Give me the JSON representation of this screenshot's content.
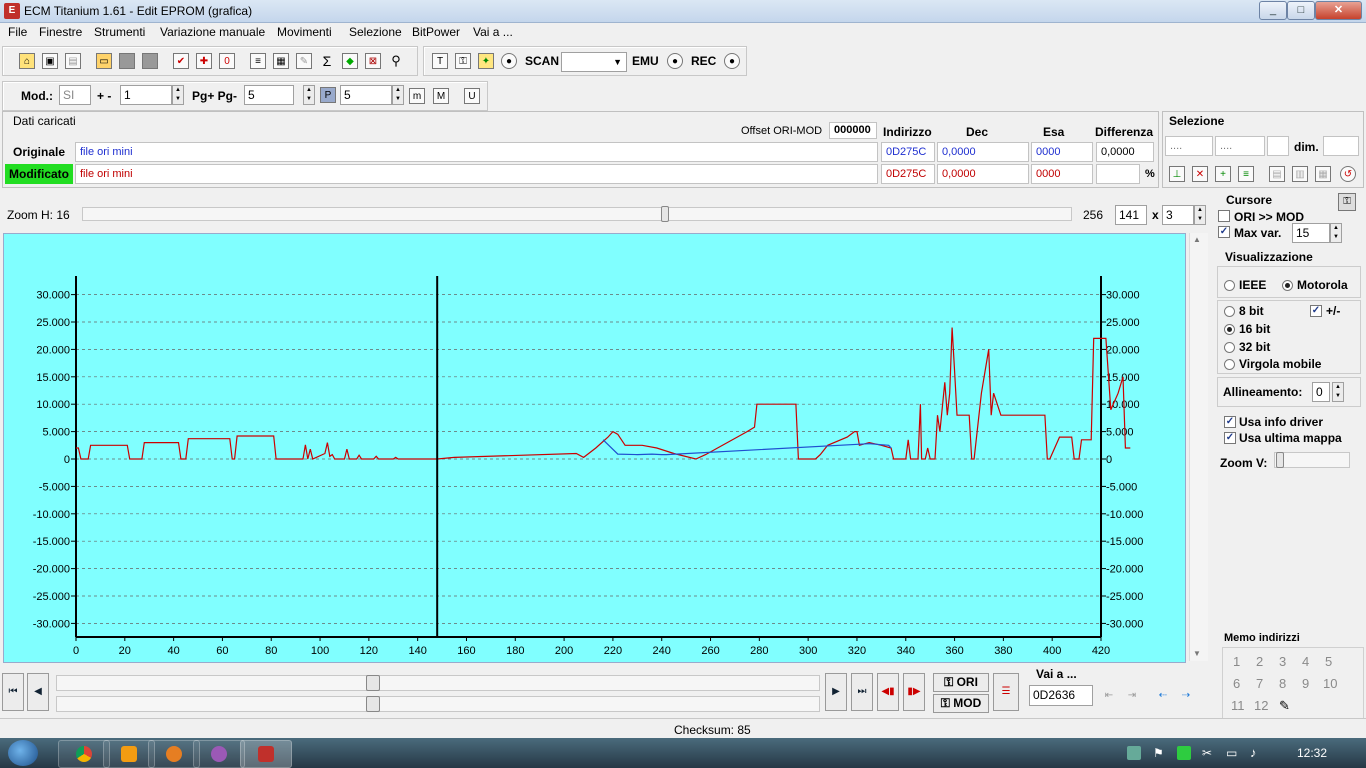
{
  "window": {
    "title": "ECM Titanium 1.61 - Edit EPROM (grafica)",
    "app_icon": "E",
    "min": "_",
    "max": "□",
    "close": "✕"
  },
  "menu": [
    "File",
    "Finestre",
    "Strumenti",
    "Variazione manuale",
    "Movimenti",
    "Selezione",
    "BitPower",
    "Vai a ..."
  ],
  "toolbar1": {
    "scan_label": "SCAN",
    "emu_label": "EMU",
    "rec_label": "REC",
    "scan_select": ""
  },
  "toolbar2": {
    "mod_label": "Mod.:",
    "mod_value": "SI",
    "plusminus_label": "+ -",
    "plusminus_value": "1",
    "pg_label": "Pg+ Pg-",
    "pg_value": "5",
    "p_value": "5",
    "btn_p": "P",
    "btn_m1": "m",
    "btn_m2": "M",
    "btn_u": "U"
  },
  "dati": {
    "title": "Dati caricati",
    "offset_label": "Offset ORI-MOD",
    "offset_value": "000000",
    "headers": {
      "indirizzo": "Indirizzo",
      "dec": "Dec",
      "esa": "Esa",
      "differenza": "Differenza"
    },
    "originale": {
      "label": "Originale",
      "file": "file ori mini",
      "indirizzo": "0D275C",
      "dec": "0,0000",
      "esa": "0000",
      "differenza": "0,0000"
    },
    "modificato": {
      "label": "Modificato",
      "file": "file ori mini",
      "indirizzo": "0D275C",
      "dec": "0,0000",
      "esa": "0000",
      "percent": "%"
    }
  },
  "selezione": {
    "title": "Selezione",
    "field1": "....",
    "field2": "....",
    "dim_label": "dim."
  },
  "zoom": {
    "label": "Zoom H: 16",
    "max_label": "256",
    "value": "141",
    "x_label": "x",
    "mult": "3",
    "level": 0.59
  },
  "cursore": {
    "title": "Cursore",
    "ori_mod": "ORI >> MOD",
    "max_var_label": "Max var.",
    "max_var_value": "15"
  },
  "visualizzazione": {
    "title": "Visualizzazione",
    "ieee": "IEEE",
    "motorola": "Motorola",
    "bit8": "8 bit",
    "bit16": "16 bit",
    "bit32": "32 bit",
    "virgola": "Virgola mobile",
    "plusminus": "+/-",
    "allineamento_label": "Allineamento:",
    "allineamento_value": "0",
    "usa_info": "Usa info driver",
    "usa_ultima": "Usa ultima mappa",
    "zoomv": "Zoom V:"
  },
  "memo": {
    "title": "Memo indirizzi",
    "numbers": [
      "1",
      "2",
      "3",
      "4",
      "5",
      "6",
      "7",
      "8",
      "9",
      "10",
      "11",
      "12"
    ]
  },
  "bottom": {
    "vai_label": "Vai a ...",
    "vai_value": "0D2636",
    "ori_btn": "ORI",
    "mod_btn": "MOD"
  },
  "status": {
    "checksum": "Checksum: 85"
  },
  "taskbar": {
    "time": "12:32"
  },
  "colors": {
    "chart_bg": "#80ffff",
    "mod_line": "#cc0000",
    "ori_line": "#1f4fd0",
    "modificato_bg": "#22dd22"
  },
  "chart_data": {
    "type": "line",
    "xlim": [
      0,
      420
    ],
    "ylim": [
      -32500,
      32500
    ],
    "x_ticks": [
      0,
      20,
      40,
      60,
      80,
      100,
      120,
      140,
      160,
      180,
      200,
      220,
      240,
      260,
      280,
      300,
      320,
      340,
      360,
      380,
      400,
      420
    ],
    "x_tick_labels": [
      "0",
      "20",
      "40",
      "60",
      "80",
      "100",
      "120",
      "140",
      "160",
      "180",
      "200",
      "220",
      "240",
      "260",
      "280",
      "300",
      "320",
      "340",
      "360",
      "380",
      "400",
      "420"
    ],
    "y_ticks": [
      30000,
      25000,
      20000,
      15000,
      10000,
      5000,
      0,
      -5000,
      -10000,
      -15000,
      -20000,
      -25000,
      -30000
    ],
    "y_tick_labels": [
      "30.000",
      "25.000",
      "20.000",
      "15.000",
      "10.000",
      "5.000",
      "0",
      "-5.000",
      "-10.000",
      "-15.000",
      "-20.000",
      "-25.000",
      "-30.000"
    ],
    "grid": true,
    "cursor_x": 148,
    "series": [
      {
        "color": "#cc0000",
        "points": [
          [
            0,
            2000
          ],
          [
            1,
            2000
          ],
          [
            2,
            0
          ],
          [
            5,
            0
          ],
          [
            6,
            2500
          ],
          [
            21,
            2500
          ],
          [
            22,
            0
          ],
          [
            27,
            0
          ],
          [
            28,
            3000
          ],
          [
            42,
            3000
          ],
          [
            43,
            0
          ],
          [
            45,
            0
          ],
          [
            46,
            3700
          ],
          [
            63,
            3700
          ],
          [
            64,
            0
          ],
          [
            65,
            0
          ],
          [
            66,
            4200
          ],
          [
            81,
            4200
          ],
          [
            82,
            0
          ],
          [
            93,
            0
          ],
          [
            94,
            2600
          ],
          [
            95,
            0
          ],
          [
            96,
            1800
          ],
          [
            97,
            0
          ],
          [
            102,
            1000
          ],
          [
            103,
            3000
          ],
          [
            104,
            500
          ],
          [
            105,
            800
          ],
          [
            106,
            0
          ],
          [
            110,
            0
          ],
          [
            111,
            1800
          ],
          [
            112,
            0
          ],
          [
            115,
            0
          ],
          [
            116,
            700
          ],
          [
            117,
            0
          ],
          [
            122,
            0
          ],
          [
            123,
            500
          ],
          [
            124,
            0
          ],
          [
            130,
            0
          ],
          [
            131,
            300
          ],
          [
            132,
            0
          ],
          [
            148,
            0
          ],
          [
            155,
            300
          ],
          [
            205,
            1000
          ],
          [
            208,
            300
          ],
          [
            213,
            2000
          ],
          [
            218,
            4000
          ],
          [
            220,
            5000
          ],
          [
            222,
            4500
          ],
          [
            225,
            2500
          ],
          [
            232,
            2500
          ],
          [
            238,
            2000
          ],
          [
            245,
            1000
          ],
          [
            254,
            0
          ],
          [
            258,
            800
          ],
          [
            275,
            5000
          ],
          [
            278,
            5800
          ],
          [
            279,
            10000
          ],
          [
            291,
            10000
          ],
          [
            295,
            10000
          ],
          [
            296,
            0
          ],
          [
            303,
            0
          ],
          [
            305,
            800
          ],
          [
            308,
            2500
          ],
          [
            316,
            4000
          ],
          [
            319,
            5000
          ],
          [
            320,
            5000
          ],
          [
            321,
            2500
          ],
          [
            325,
            3000
          ],
          [
            330,
            2500
          ],
          [
            334,
            2000
          ],
          [
            335,
            0
          ],
          [
            340,
            0
          ],
          [
            341,
            3500
          ],
          [
            342,
            0
          ],
          [
            345,
            0
          ],
          [
            346,
            10000
          ],
          [
            346.5,
            0
          ],
          [
            348,
            0
          ],
          [
            349,
            2000
          ],
          [
            350,
            0
          ],
          [
            352,
            0
          ],
          [
            353,
            8000
          ],
          [
            354,
            5000
          ],
          [
            356,
            14000
          ],
          [
            357,
            8000
          ],
          [
            358,
            12000
          ],
          [
            359,
            24000
          ],
          [
            360,
            16000
          ],
          [
            361,
            8000
          ],
          [
            366,
            8000
          ],
          [
            367,
            0
          ],
          [
            368,
            0
          ],
          [
            371,
            12000
          ],
          [
            374,
            20000
          ],
          [
            375,
            8000
          ],
          [
            376,
            12000
          ],
          [
            379,
            8000
          ],
          [
            389,
            8000
          ],
          [
            397,
            8000
          ],
          [
            398,
            0
          ],
          [
            399,
            0
          ],
          [
            403,
            4000
          ],
          [
            408,
            4000
          ],
          [
            409,
            0
          ],
          [
            411,
            0
          ],
          [
            412,
            3500
          ],
          [
            416,
            3500
          ],
          [
            417,
            22000
          ],
          [
            422,
            22000
          ],
          [
            424,
            9000
          ],
          [
            427,
            12000
          ],
          [
            429,
            15000
          ],
          [
            430,
            2000
          ],
          [
            432,
            2000
          ]
        ]
      },
      {
        "color": "#1f4fd0",
        "points": [
          [
            216,
            3500
          ],
          [
            222,
            900
          ],
          [
            230,
            800
          ],
          [
            236,
            900
          ],
          [
            240,
            800
          ],
          [
            242,
            800
          ],
          [
            325,
            2800
          ],
          [
            333,
            2500
          ],
          [
            334,
            2000
          ]
        ]
      }
    ]
  }
}
